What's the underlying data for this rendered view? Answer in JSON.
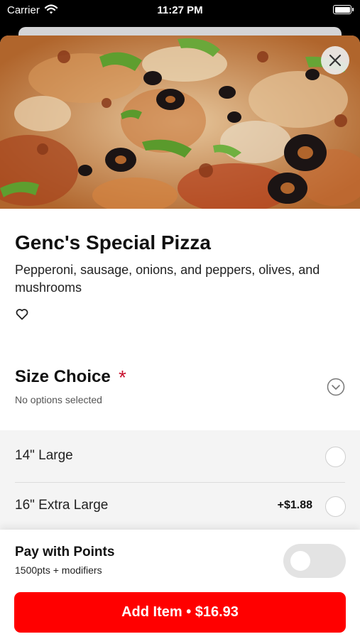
{
  "status_bar": {
    "carrier": "Carrier",
    "time": "11:27 PM",
    "icons": [
      "wifi-icon",
      "battery-icon"
    ]
  },
  "item": {
    "title": "Genc's Special Pizza",
    "description": "Pepperoni, sausage, onions, and peppers, olives, and mushrooms",
    "image": "pizza-photo",
    "favorite_icon": "heart-outline-icon",
    "close_icon": "close-icon"
  },
  "modifier_group": {
    "title": "Size Choice",
    "required_marker": "*",
    "subtitle": "No options selected",
    "collapse_icon": "chevron-down-circle-icon",
    "options": [
      {
        "label": "14\" Large",
        "price": "",
        "selected": false
      },
      {
        "label": "16\" Extra Large",
        "price": "+$1.88",
        "selected": false
      }
    ]
  },
  "footer": {
    "points_label": "Pay with Points",
    "points_sub": "1500pts + modifiers",
    "points_toggle_on": false,
    "add_button_label": "Add Item • $16.93"
  },
  "colors": {
    "accent": "#ff0000",
    "required": "#c8102e",
    "options_bg": "#f4f4f4",
    "toggle_off": "#e3e3e3"
  }
}
